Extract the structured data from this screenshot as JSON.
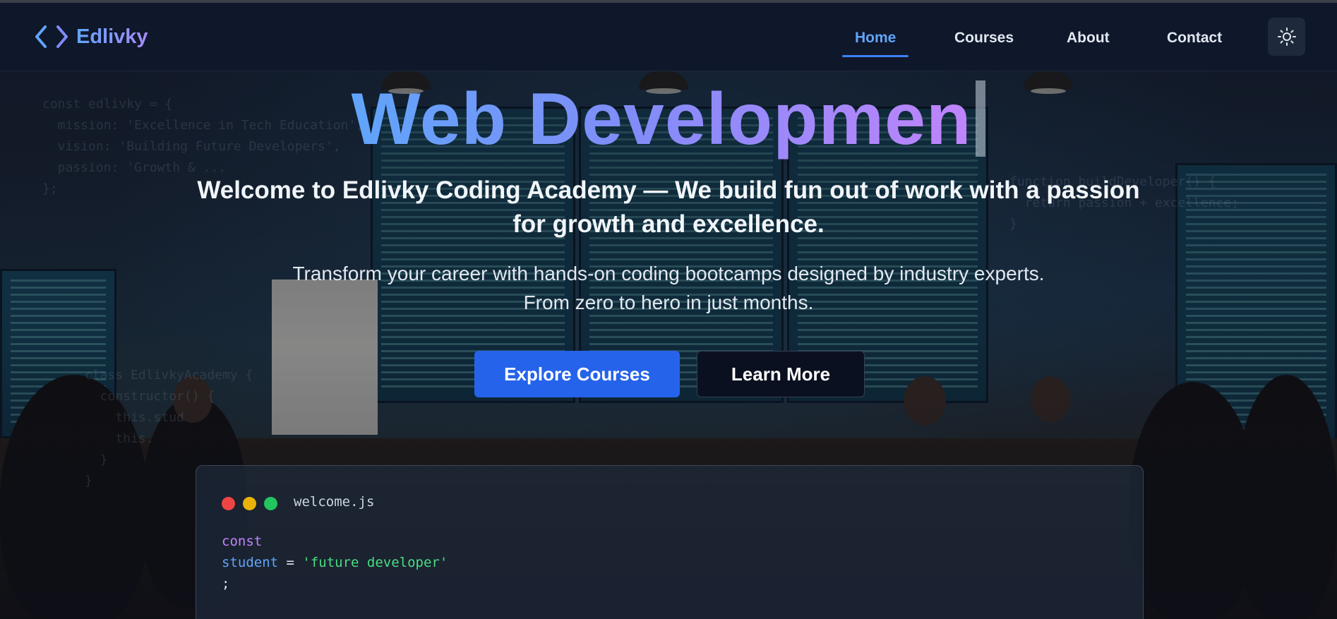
{
  "brand": {
    "name": "Edlivky",
    "icon": "code-brackets-icon"
  },
  "nav": {
    "items": [
      {
        "label": "Home",
        "active": true
      },
      {
        "label": "Courses",
        "active": false
      },
      {
        "label": "About",
        "active": false
      },
      {
        "label": "Contact",
        "active": false
      }
    ],
    "theme_toggle_icon": "sun-icon"
  },
  "hero": {
    "typed_title": "Web Developmen",
    "subtitle": "Welcome to Edlivky Coding Academy — We build fun out of work with a passion for growth and excellence.",
    "description_line1": "Transform your career with hands-on coding bootcamps designed by industry experts.",
    "description_line2": "From zero to hero in just months.",
    "primary_button": "Explore Courses",
    "secondary_button": "Learn More"
  },
  "background_code": {
    "block1": "const edlivky = {\n  mission: 'Excellence in Tech Education',\n  vision: 'Building Future Developers',\n  passion: 'Growth & ...\n};",
    "block2": "function buildDeveloper() {\n  return passion + excellence;\n}",
    "block3": "class EdlivkyAcademy {\n  constructor() {\n    this.stud\n    this.\n  }\n}"
  },
  "code_card": {
    "filename": "welcome.js",
    "line1_keyword": "const",
    "line2_var": "student",
    "line2_op": " = ",
    "line2_string": "'future developer'",
    "line3": ";"
  },
  "colors": {
    "accent": "#3b82f6",
    "primary_button": "#2563eb",
    "gradient_start": "#60a5fa",
    "gradient_end": "#c084fc",
    "dot_red": "#ef4444",
    "dot_yellow": "#eab308",
    "dot_green": "#22c55e"
  }
}
